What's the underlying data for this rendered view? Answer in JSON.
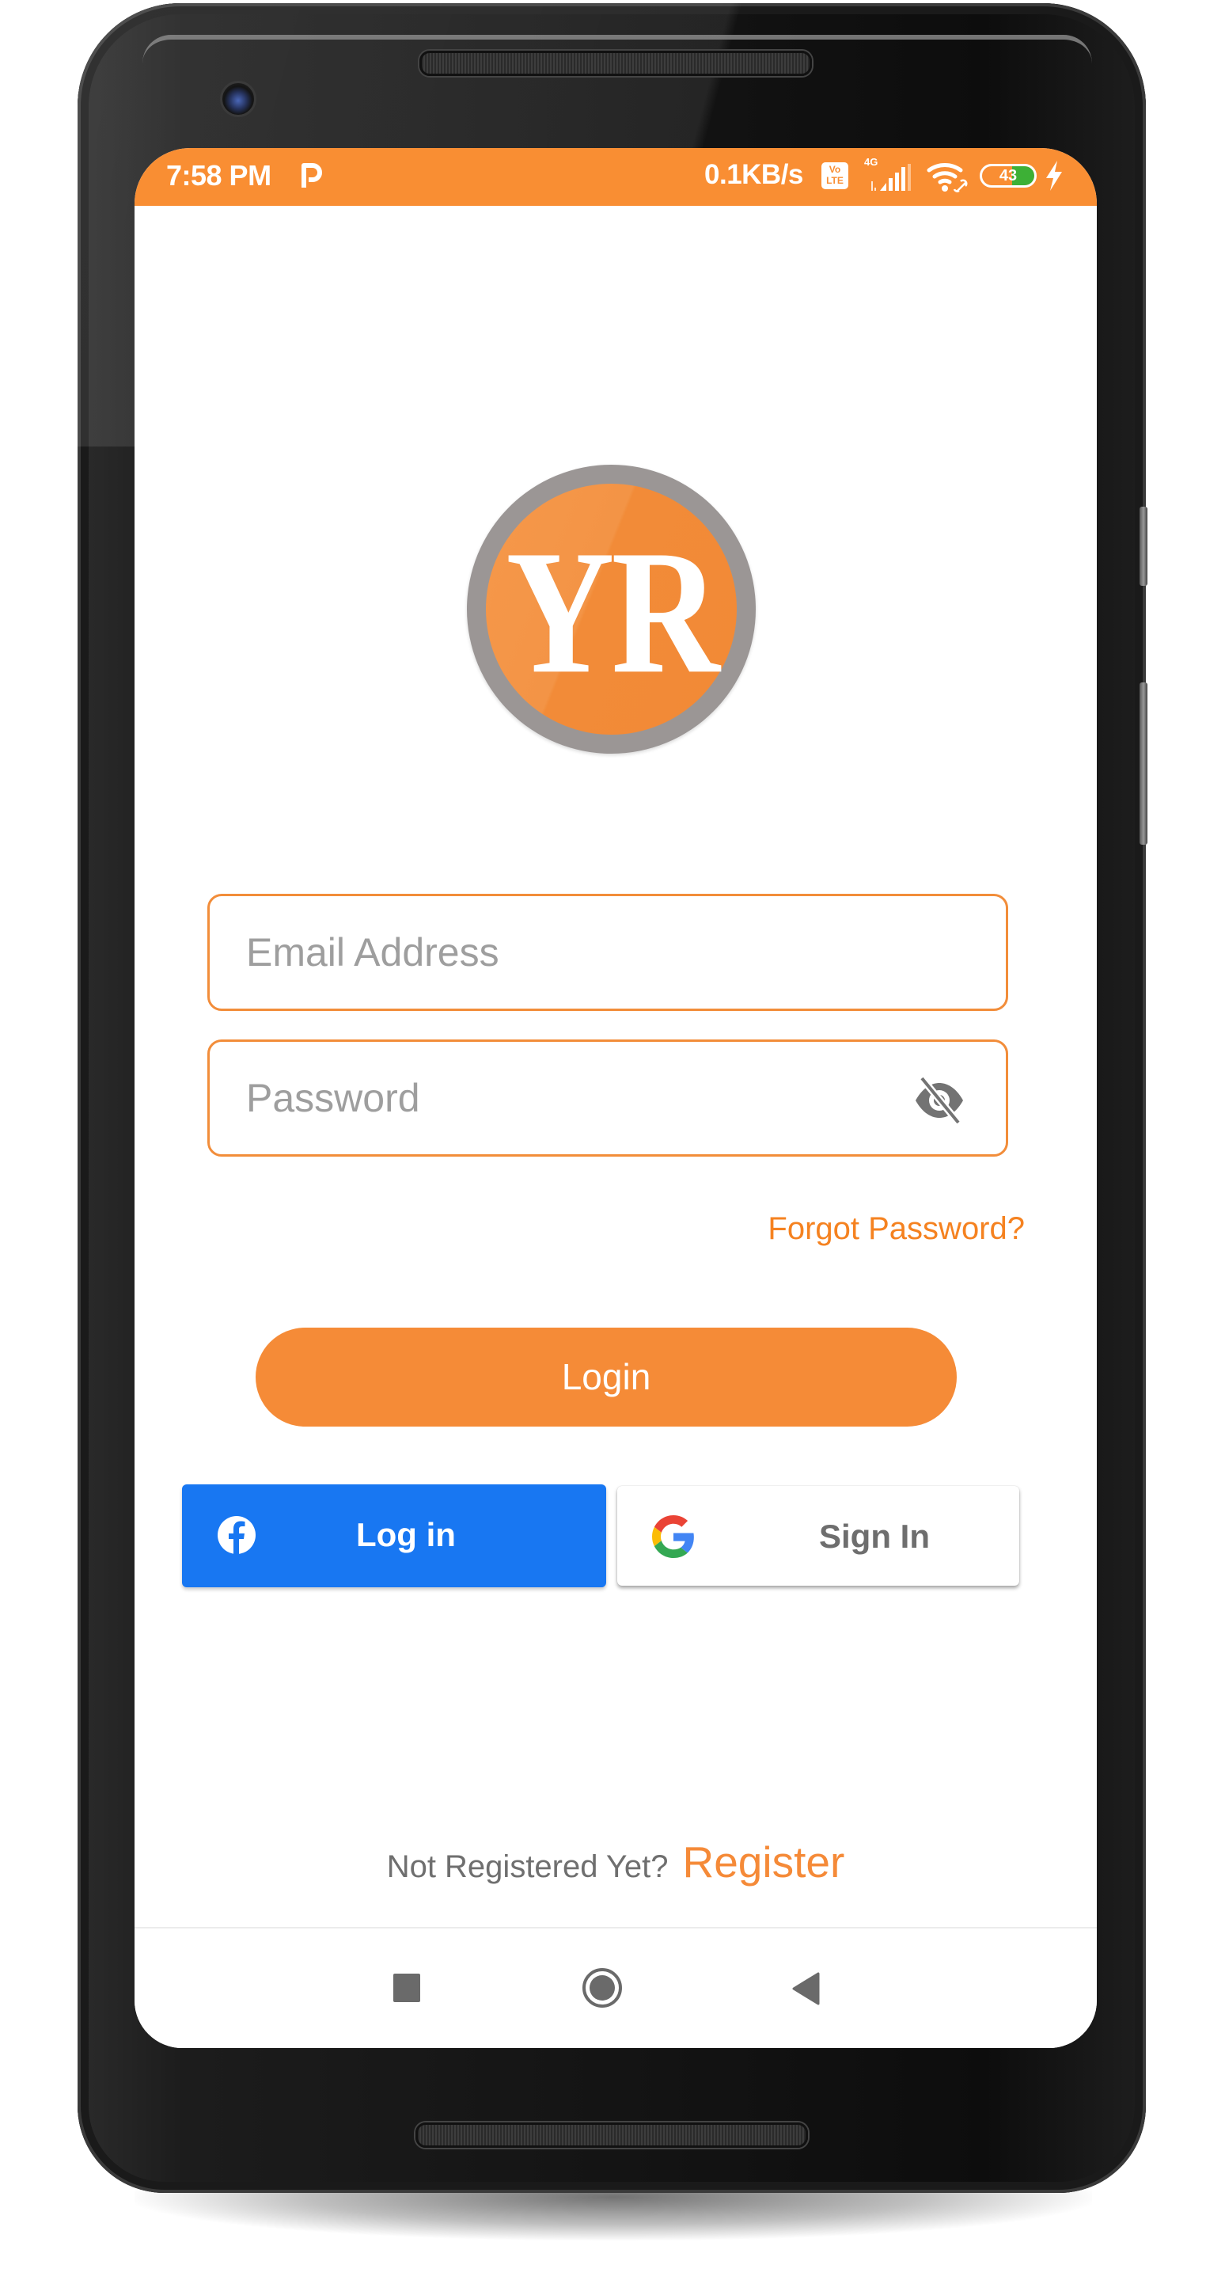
{
  "colors": {
    "brand_orange": "#f98e33",
    "button_orange": "#f58b37",
    "link_orange": "#f58220",
    "facebook_blue": "#1877f2",
    "battery_green": "#3db036",
    "placeholder_gray": "#9e9e9e"
  },
  "status_bar": {
    "time": "7:58 PM",
    "notification_icon": "p-app-icon",
    "network_speed": "0.1KB/s",
    "volte_top": "Vo",
    "volte_bottom": "LTE",
    "network_type": "4G",
    "signal_icon": "signal-bars-icon",
    "wifi_icon": "wifi-link-icon",
    "battery_level": "43",
    "battery_fraction": 0.43,
    "charging_icon": "bolt-icon"
  },
  "logo": {
    "text": "YR"
  },
  "form": {
    "email": {
      "placeholder": "Email Address",
      "value": ""
    },
    "password": {
      "placeholder": "Password",
      "value": "",
      "toggle_icon": "eye-off-icon"
    },
    "forgot_password": "Forgot Password?",
    "login_button": "Login"
  },
  "social": {
    "facebook": {
      "icon": "facebook-icon",
      "label": "Log in"
    },
    "google": {
      "icon": "google-icon",
      "label": "Sign In"
    }
  },
  "register": {
    "prompt": "Not Registered Yet?",
    "link": "Register"
  },
  "nav_bar": {
    "recents_icon": "square-icon",
    "home_icon": "circle-icon",
    "back_icon": "triangle-back-icon"
  }
}
